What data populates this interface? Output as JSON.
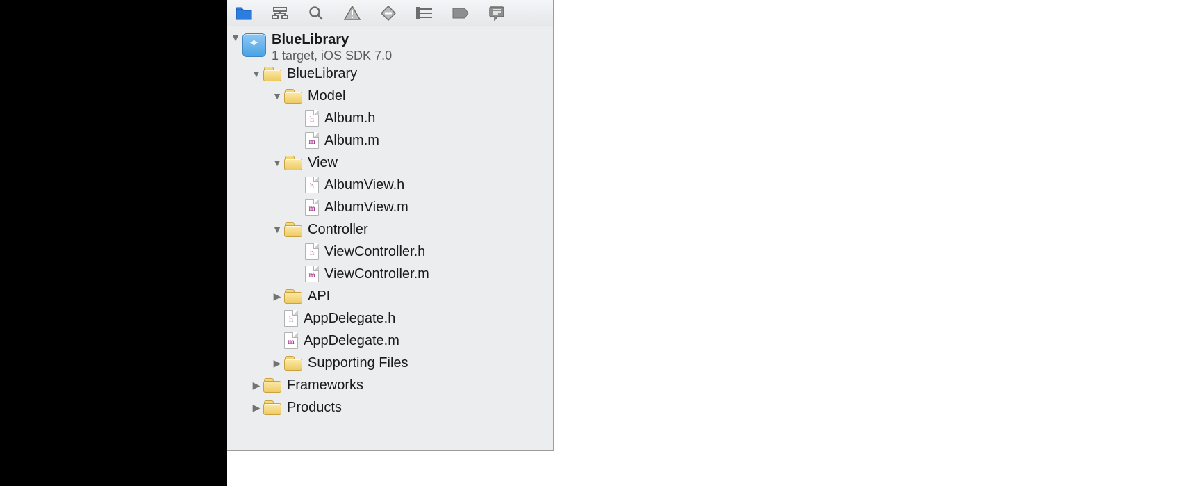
{
  "toolbar_icons": [
    "folder",
    "symbols",
    "search",
    "issues",
    "debug",
    "breakpoints",
    "tag",
    "log"
  ],
  "project": {
    "name": "BlueLibrary",
    "subtitle": "1 target, iOS SDK 7.0"
  },
  "tree": [
    {
      "depth": 1,
      "kind": "folder",
      "disc": "open",
      "label": "BlueLibrary"
    },
    {
      "depth": 2,
      "kind": "folder",
      "disc": "open",
      "label": "Model"
    },
    {
      "depth": 3,
      "kind": "file-h",
      "disc": "blank",
      "label": "Album.h"
    },
    {
      "depth": 3,
      "kind": "file-m",
      "disc": "blank",
      "label": "Album.m"
    },
    {
      "depth": 2,
      "kind": "folder",
      "disc": "open",
      "label": "View"
    },
    {
      "depth": 3,
      "kind": "file-h",
      "disc": "blank",
      "label": "AlbumView.h"
    },
    {
      "depth": 3,
      "kind": "file-m",
      "disc": "blank",
      "label": "AlbumView.m"
    },
    {
      "depth": 2,
      "kind": "folder",
      "disc": "open",
      "label": "Controller"
    },
    {
      "depth": 3,
      "kind": "file-h",
      "disc": "blank",
      "label": "ViewController.h"
    },
    {
      "depth": 3,
      "kind": "file-m",
      "disc": "blank",
      "label": "ViewController.m"
    },
    {
      "depth": 2,
      "kind": "folder",
      "disc": "closed",
      "label": "API"
    },
    {
      "depth": 2,
      "kind": "file-h",
      "disc": "blank",
      "label": "AppDelegate.h"
    },
    {
      "depth": 2,
      "kind": "file-m",
      "disc": "blank",
      "label": "AppDelegate.m"
    },
    {
      "depth": 2,
      "kind": "folder",
      "disc": "closed",
      "label": "Supporting Files"
    },
    {
      "depth": 1,
      "kind": "folder",
      "disc": "closed",
      "label": "Frameworks"
    },
    {
      "depth": 1,
      "kind": "folder",
      "disc": "closed",
      "label": "Products"
    }
  ]
}
